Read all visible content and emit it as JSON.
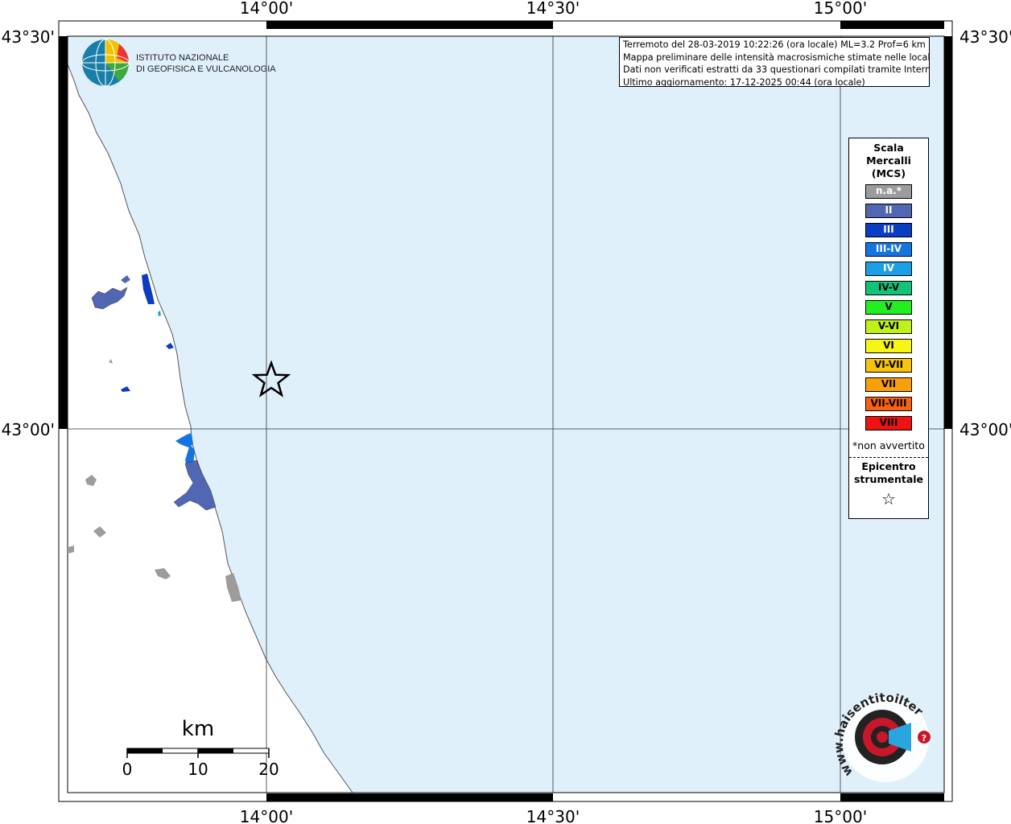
{
  "colors": {
    "sea": "#dff0fb",
    "land": "#ffffff",
    "frame": "#000000"
  },
  "axes": {
    "lon_ticks": [
      "14°00'",
      "14°30'",
      "15°00'"
    ],
    "lat_ticks": [
      "43°30'",
      "43°00'"
    ]
  },
  "institution": {
    "line1": "ISTITUTO NAZIONALE",
    "line2": "DI GEOFISICA E VULCANOLOGIA"
  },
  "info": {
    "line1": "Terremoto del 28-03-2019 10:22:26 (ora locale) ML=3.2 Prof=6 km",
    "line2": "Mappa preliminare delle intensità macrosismiche stimate nelle località",
    "line3": "Dati non verificati estratti da 33 questionari compilati tramite Internet.",
    "line4": "Ultimo aggiornamento: 17-12-2025 00:44 (ora locale)"
  },
  "legend": {
    "title1": "Scala",
    "title2": "Mercalli",
    "title3": "(MCS)",
    "items": [
      {
        "label": "n.a.*",
        "color": "#9c9c9c",
        "text_color": "#ffffff"
      },
      {
        "label": "II",
        "color": "#5267b4",
        "text_color": "#ffffff"
      },
      {
        "label": "III",
        "color": "#0a3dc2",
        "text_color": "#ffffff"
      },
      {
        "label": "III-IV",
        "color": "#1474e0",
        "text_color": "#ffffff"
      },
      {
        "label": "IV",
        "color": "#1ba0e8",
        "text_color": "#ffffff"
      },
      {
        "label": "IV-V",
        "color": "#11c47a",
        "text_color": "#000000"
      },
      {
        "label": "V",
        "color": "#22ee22",
        "text_color": "#000000"
      },
      {
        "label": "V-VI",
        "color": "#bff21a",
        "text_color": "#000000"
      },
      {
        "label": "VI",
        "color": "#f5f516",
        "text_color": "#000000"
      },
      {
        "label": "VI-VII",
        "color": "#f8c30d",
        "text_color": "#000000"
      },
      {
        "label": "VII",
        "color": "#f8a00a",
        "text_color": "#000000"
      },
      {
        "label": "VII-VIII",
        "color": "#f86210",
        "text_color": "#000000"
      },
      {
        "label": "VIII",
        "color": "#ee1212",
        "text_color": "#000000"
      }
    ],
    "note": "*non avvertito",
    "epicenter1": "Epicentro",
    "epicenter2": "strumentale",
    "star": "☆"
  },
  "scale_bar": {
    "unit": "km",
    "labels": [
      "0",
      "10",
      "20"
    ]
  },
  "site_logo": {
    "text": "www.haisentitoilterremoto.it"
  }
}
